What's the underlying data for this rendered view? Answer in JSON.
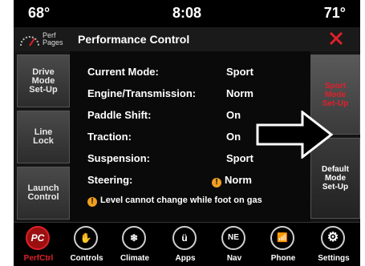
{
  "status_bar": {
    "temp_left": "68°",
    "time": "8:08",
    "temp_right": "71°"
  },
  "title_bar": {
    "perf_pages_label": "Perf\nPages",
    "title": "Performance Control",
    "close_icon": "close-x-icon"
  },
  "left_menu": {
    "items": [
      {
        "label": "Drive\nMode\nSet-Up"
      },
      {
        "label": "Line\nLock"
      },
      {
        "label": "Launch\nControl"
      }
    ]
  },
  "settings": {
    "rows": [
      {
        "label": "Current Mode:",
        "value": "Sport"
      },
      {
        "label": "Engine/Transmission:",
        "value": "Norm"
      },
      {
        "label": "Paddle Shift:",
        "value": "On"
      },
      {
        "label": "Traction:",
        "value": "On"
      },
      {
        "label": "Suspension:",
        "value": "Sport"
      },
      {
        "label": "Steering:",
        "value": "Norm"
      }
    ],
    "warning_icon": "!",
    "notice": "Level cannot change while foot on gas"
  },
  "right_menu": {
    "items": [
      {
        "label": "Sport\nMode\nSet-Up"
      },
      {
        "label": "Default\nMode\nSet-Up"
      }
    ]
  },
  "bottom_nav": {
    "items": [
      {
        "label": "PerfCtrl",
        "icon_text": "PC"
      },
      {
        "label": "Controls",
        "icon_text": "✋"
      },
      {
        "label": "Climate",
        "icon_text": "❄"
      },
      {
        "label": "Apps",
        "icon_text": "ü"
      },
      {
        "label": "Nav",
        "icon_text": "NE"
      },
      {
        "label": "Phone",
        "icon_text": "📶"
      },
      {
        "label": "Settings",
        "icon_text": "⚙"
      }
    ]
  },
  "colors": {
    "accent_red": "#e0202a",
    "warning_orange": "#f0a020"
  }
}
